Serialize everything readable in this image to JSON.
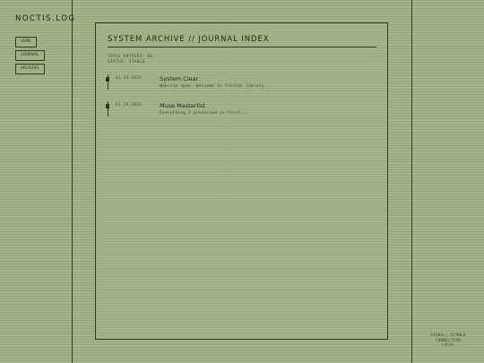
{
  "site": {
    "logo": "NOCTIS.LOG"
  },
  "nav": {
    "items": [
      {
        "label": "HOME"
      },
      {
        "label": "JOURNAL"
      },
      {
        "label": "ARCHIVE"
      }
    ]
  },
  "panel": {
    "title": "SYSTEM ARCHIVE // JOURNAL INDEX",
    "total_entries": "TOTAL ENTRIES: 02",
    "status": "STATUS: STABLE"
  },
  "entries": [
    {
      "date": "01.19.2026",
      "title": "System Clear",
      "desc": "Website open. Welcome to fractal library..."
    },
    {
      "date": "01.19.2026",
      "title": "Muse Masterlist",
      "desc": "Everything I preserved in first..."
    }
  ],
  "footer": {
    "signal": "SIGNAL: STABLE",
    "connection": "CONNECTION",
    "mode": "LOCAL"
  }
}
